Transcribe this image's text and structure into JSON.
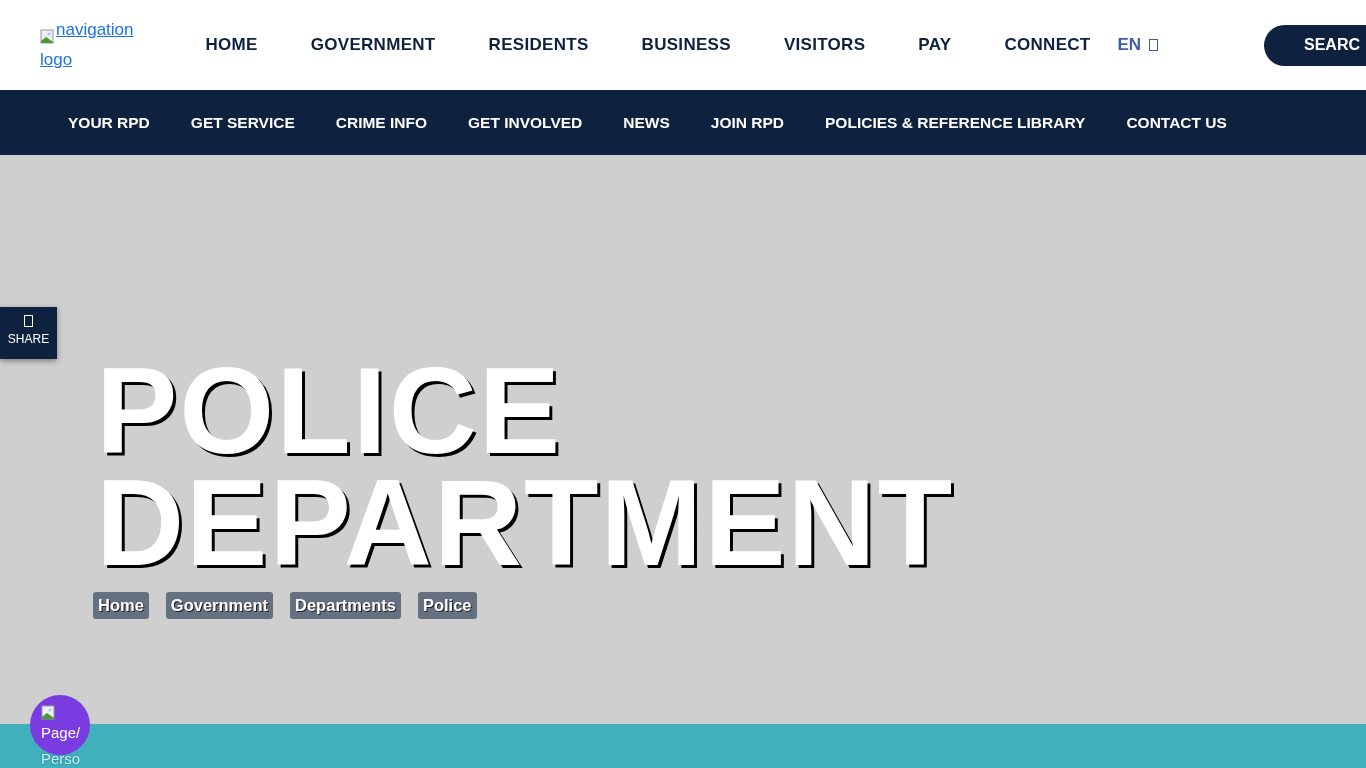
{
  "header": {
    "logo_alt": [
      "navigation",
      "logo"
    ],
    "menu": [
      "HOME",
      "GOVERNMENT",
      "RESIDENTS",
      "BUSINESS",
      "VISITORS",
      "PAY",
      "CONNECT"
    ],
    "language": "EN",
    "search_button": "SEARC"
  },
  "subnav": [
    "YOUR RPD",
    "GET SERVICE",
    "CRIME INFO",
    "GET INVOLVED",
    "NEWS",
    "JOIN RPD",
    "POLICIES & REFERENCE LIBRARY",
    "CONTACT US"
  ],
  "share": {
    "label": "SHARE"
  },
  "hero": {
    "title_lines": [
      "POLICE",
      "DEPARTMENT"
    ],
    "breadcrumb": [
      "Home",
      "Government",
      "Departments",
      "Police"
    ]
  },
  "floating_button": {
    "alt_lines": [
      "Page/",
      "Perso"
    ]
  }
}
